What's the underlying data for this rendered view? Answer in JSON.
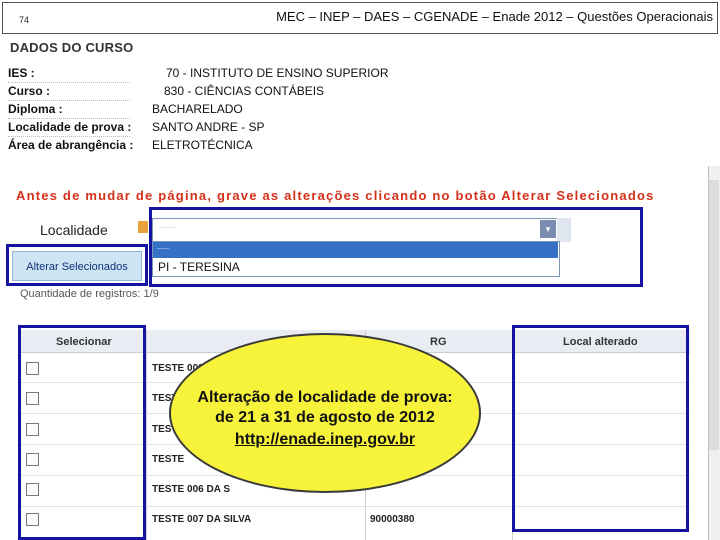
{
  "header": {
    "page_number": "74",
    "title": "MEC – INEP – DAES – CGENADE – Enade 2012 – Questões Operacionais"
  },
  "course": {
    "section_title": "DADOS DO CURSO",
    "fields": [
      {
        "label": "IES :",
        "value": "70 - INSTITUTO DE ENSINO SUPERIOR"
      },
      {
        "label": "Curso :",
        "value": "830 - CIÊNCIAS CONTÁBEIS"
      },
      {
        "label": "Diploma :",
        "value": "BACHARELADO"
      },
      {
        "label": "Localidade de prova :",
        "value": "SANTO ANDRE - SP"
      },
      {
        "label": "Área de abrangência :",
        "value": "ELETROTÉCNICA"
      }
    ]
  },
  "warning": "Antes de mudar de página, grave as alterações clicando no botão Alterar Selecionados",
  "localidade": {
    "label": "Localidade",
    "select_placeholder": "------",
    "highlighted_option": "------",
    "option": "PI - TERESINA"
  },
  "alter_button": "Alterar Selecionados",
  "record_count": "Quantidade de registros: 1/9",
  "table": {
    "headers": {
      "select": "Selecionar",
      "rg": "RG",
      "local": "Local alterado"
    },
    "rows": [
      {
        "name": "TESTE 002",
        "rg": ""
      },
      {
        "name": "TESTE",
        "rg": ""
      },
      {
        "name": "TESTE",
        "rg": ""
      },
      {
        "name": "TESTE",
        "rg": ""
      },
      {
        "name": "TESTE 006 DA S",
        "rg": ""
      },
      {
        "name": "TESTE 007 DA SILVA",
        "rg": "90000380"
      }
    ]
  },
  "callout": {
    "line1": "Alteração de localidade de prova:",
    "line2": "de 21 a 31 de agosto de 2012",
    "link": "http://enade.inep.gov.br"
  },
  "colors": {
    "annotation_border": "#1414a0",
    "warning_text": "#d4301a",
    "callout_fill": "#f7f23a",
    "dropdown_highlight": "#3572c6"
  }
}
